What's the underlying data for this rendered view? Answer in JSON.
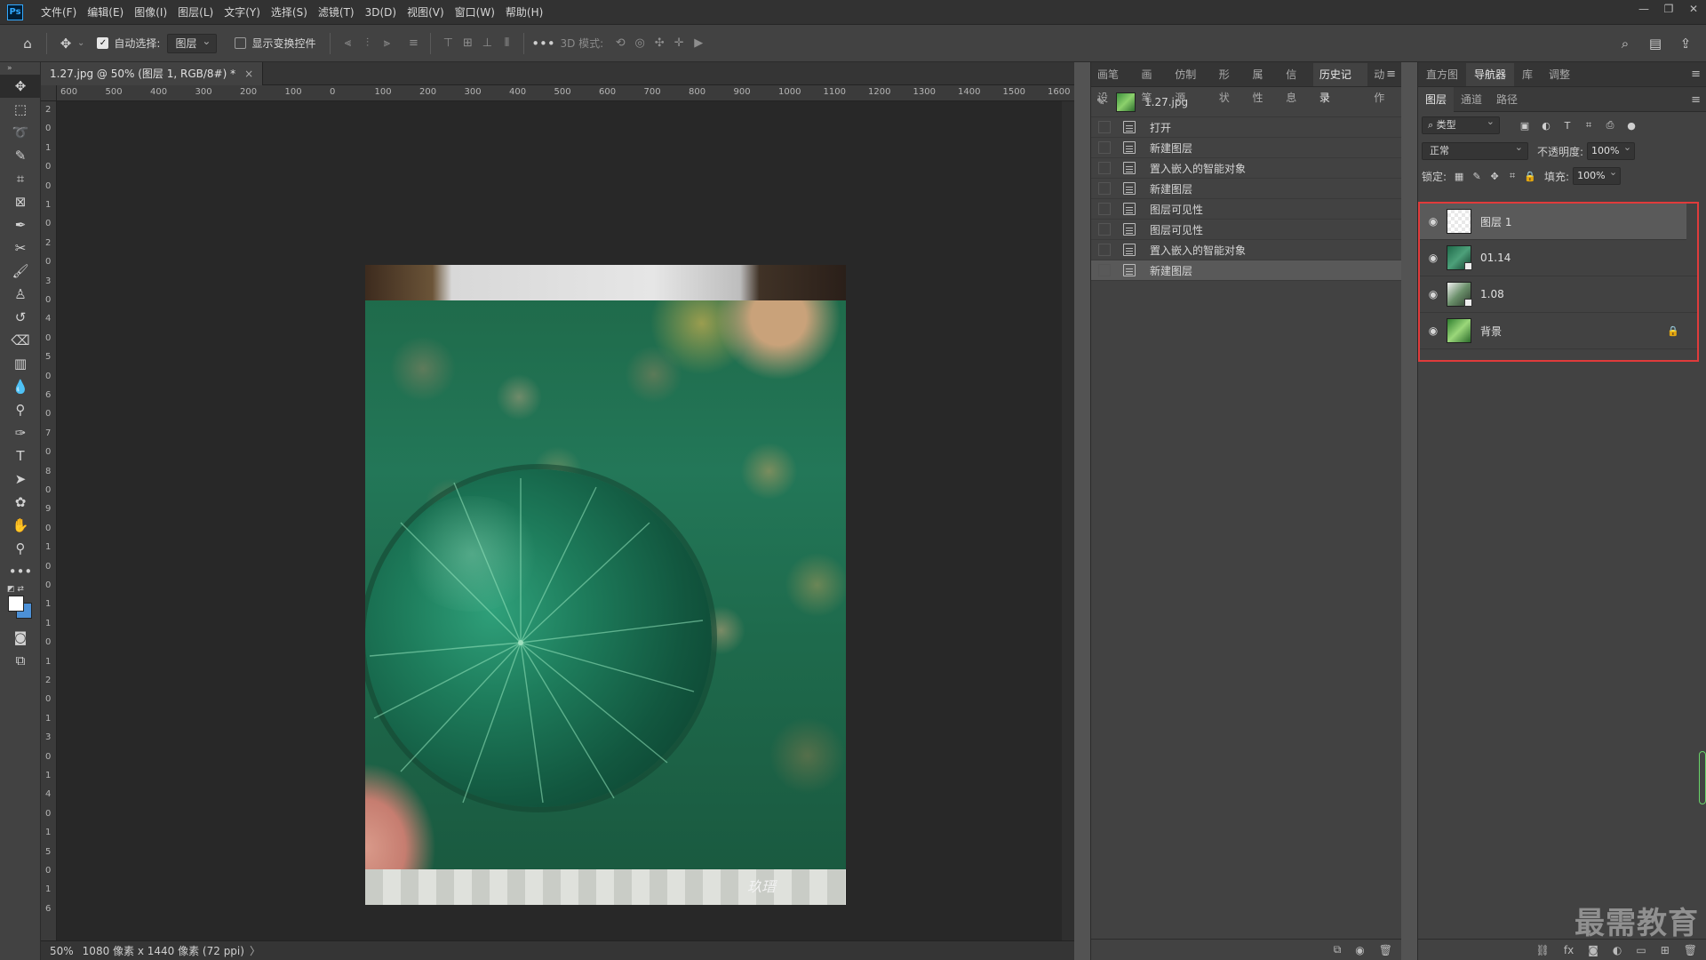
{
  "app": {
    "logo": "Ps"
  },
  "menu": [
    "文件(F)",
    "编辑(E)",
    "图像(I)",
    "图层(L)",
    "文字(Y)",
    "选择(S)",
    "滤镜(T)",
    "3D(D)",
    "视图(V)",
    "窗口(W)",
    "帮助(H)"
  ],
  "options": {
    "auto_select_label": "自动选择:",
    "auto_select_checked": true,
    "target_value": "图层",
    "show_transform_label": "显示变换控件",
    "mode_3d_label": "3D 模式:"
  },
  "document": {
    "tab_title": "1.27.jpg @ 50% (图层 1, RGB/8#) *",
    "zoom": "50%",
    "info": "1080 像素 x 1440 像素 (72 ppi)",
    "hruler_ticks": [
      "600",
      "500",
      "400",
      "300",
      "200",
      "100",
      "0",
      "100",
      "200",
      "300",
      "400",
      "500",
      "600",
      "700",
      "800",
      "900",
      "1000",
      "1100",
      "1200",
      "1300",
      "1400",
      "1500",
      "1600"
    ],
    "vruler_ticks": [
      "2",
      "0",
      "1",
      "0",
      "0",
      "1",
      "0",
      "2",
      "0",
      "3",
      "0",
      "4",
      "0",
      "5",
      "0",
      "6",
      "0",
      "7",
      "0",
      "8",
      "0",
      "9",
      "0",
      "1",
      "0",
      "0",
      "1",
      "1",
      "0",
      "1",
      "2",
      "0",
      "1",
      "3",
      "0",
      "1",
      "4",
      "0",
      "1",
      "5",
      "0",
      "1",
      "6"
    ],
    "signature": "玖瑨"
  },
  "history_panel": {
    "tabs": [
      "画笔设",
      "画笔",
      "仿制源",
      "形状",
      "属性",
      "信息",
      "历史记录",
      "动作"
    ],
    "active_tab": "历史记录",
    "source": "1.27.jpg",
    "items": [
      "打开",
      "新建图层",
      "置入嵌入的智能对象",
      "新建图层",
      "图层可见性",
      "图层可见性",
      "置入嵌入的智能对象",
      "新建图层"
    ],
    "selected_index": 7
  },
  "top_right_tabs": {
    "tabs": [
      "直方图",
      "导航器",
      "库",
      "调整"
    ],
    "active_tab": "导航器"
  },
  "layers_panel": {
    "tabs": [
      "图层",
      "通道",
      "路径"
    ],
    "active_tab": "图层",
    "kind_filter": "类型",
    "blend_mode": "正常",
    "opacity_label": "不透明度:",
    "opacity": "100%",
    "lock_label": "锁定:",
    "fill_label": "填充:",
    "fill": "100%",
    "layers": [
      {
        "name": "图层 1",
        "thumb": "transparent",
        "selected": true,
        "locked": false
      },
      {
        "name": "01.14",
        "thumb": "smart-object",
        "selected": false,
        "locked": false
      },
      {
        "name": "1.08",
        "thumb": "smart-object",
        "selected": false,
        "locked": false
      },
      {
        "name": "背景",
        "thumb": "background",
        "selected": false,
        "locked": true
      }
    ]
  },
  "watermark": "最需教育",
  "highlight_color": "#e03b3b"
}
